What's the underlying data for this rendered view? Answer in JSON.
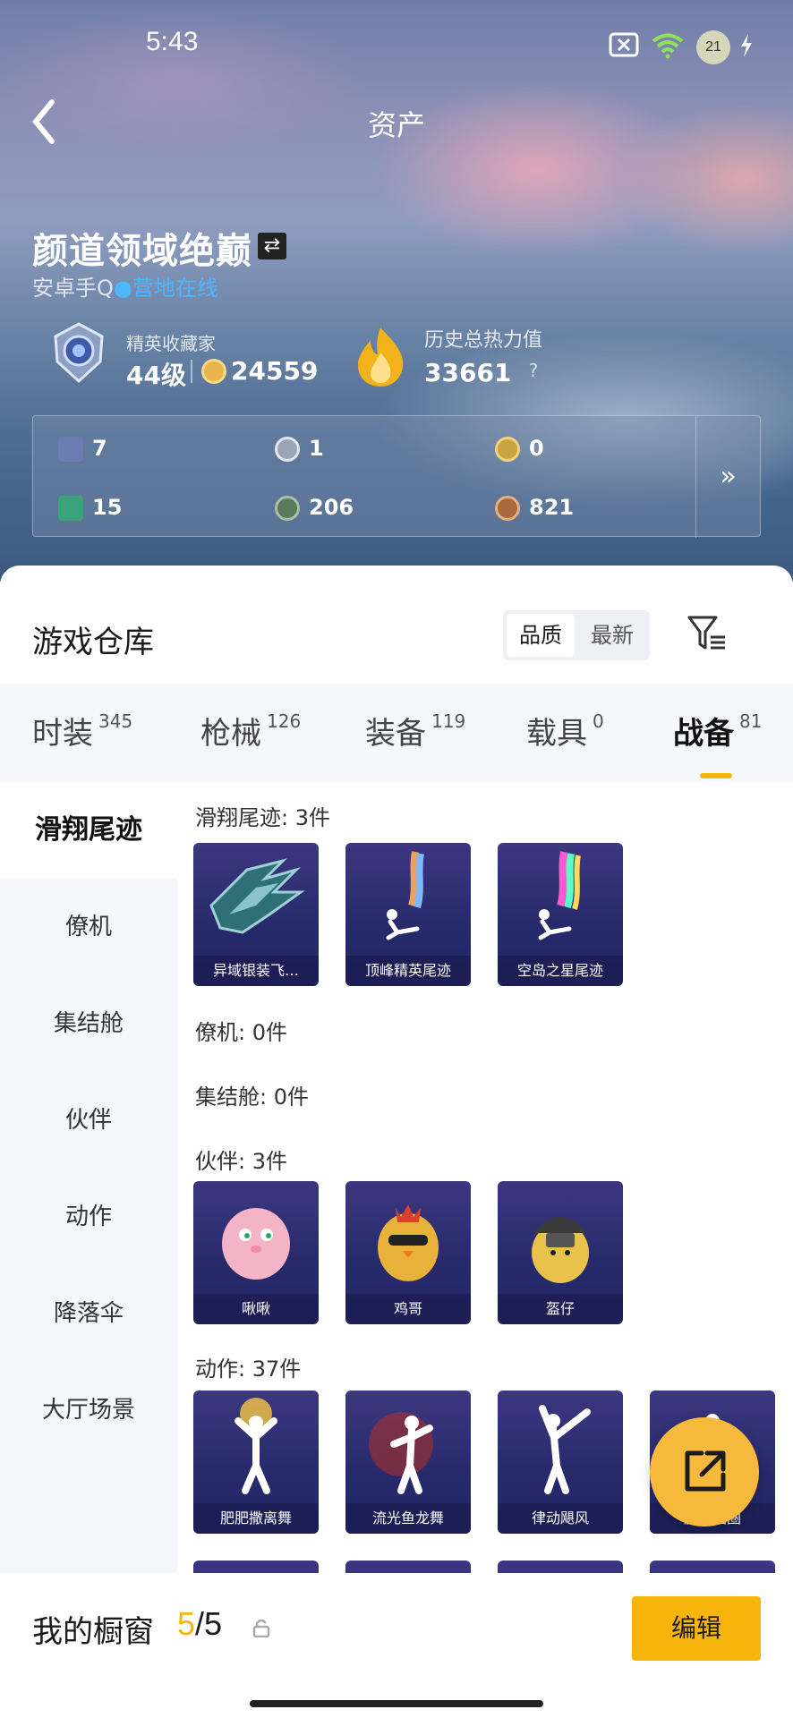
{
  "status": {
    "time": "5:43",
    "battery_level": "21"
  },
  "header": {
    "title": "资产"
  },
  "player": {
    "name": "颜道领域绝巅",
    "platform": "安卓手Q",
    "online_dot": "●",
    "online_text": "营地在线",
    "rank_label": "精英收藏家",
    "level": "44级",
    "coins": "24559",
    "heat_label": "历史总热力值",
    "heat_value": "33661",
    "help": "?"
  },
  "resources": [
    {
      "icon": "card-icon",
      "value": "7",
      "color": "#6b7db0"
    },
    {
      "icon": "silver-token-icon",
      "value": "1",
      "color": "#9aa4b5"
    },
    {
      "icon": "gold-token-icon",
      "value": "0",
      "color": "#c9a440"
    },
    {
      "icon": "green-card-icon",
      "value": "15",
      "color": "#3aa37a"
    },
    {
      "icon": "green-orb-icon",
      "value": "206",
      "color": "#5a7a5e"
    },
    {
      "icon": "bronze-token-icon",
      "value": "821",
      "color": "#a8693c"
    }
  ],
  "warehouse": {
    "title": "游戏仓库",
    "sort_quality": "品质",
    "sort_newest": "最新"
  },
  "tabs": [
    {
      "label": "时装",
      "count": "345"
    },
    {
      "label": "枪械",
      "count": "126"
    },
    {
      "label": "装备",
      "count": "119"
    },
    {
      "label": "载具",
      "count": "0"
    },
    {
      "label": "战备",
      "count": "81"
    }
  ],
  "sidebar": [
    "滑翔尾迹",
    "僚机",
    "集结舱",
    "伙伴",
    "动作",
    "降落伞",
    "大厅场景"
  ],
  "sections": {
    "glide": {
      "title": "滑翔尾迹: 3件",
      "items": [
        "异域银装飞…",
        "顶峰精英尾迹",
        "空岛之星尾迹"
      ]
    },
    "wingman": {
      "title": "僚机: 0件"
    },
    "pod": {
      "title": "集结舱: 0件"
    },
    "partner": {
      "title": "伙伴: 3件",
      "items": [
        "啾啾",
        "鸡哥",
        "盔仔"
      ]
    },
    "emote": {
      "title": "动作: 37件",
      "items": [
        "肥肥撒离舞",
        "流光鱼龙舞",
        "律动飓风",
        "魔力圈圈"
      ]
    }
  },
  "bottom": {
    "label": "我的橱窗",
    "current": "5",
    "sep_total": "/5",
    "edit": "编辑"
  },
  "colors": {
    "accent": "#f5b50a",
    "online": "#4fb6ff",
    "tile_bg": "#26296a"
  }
}
